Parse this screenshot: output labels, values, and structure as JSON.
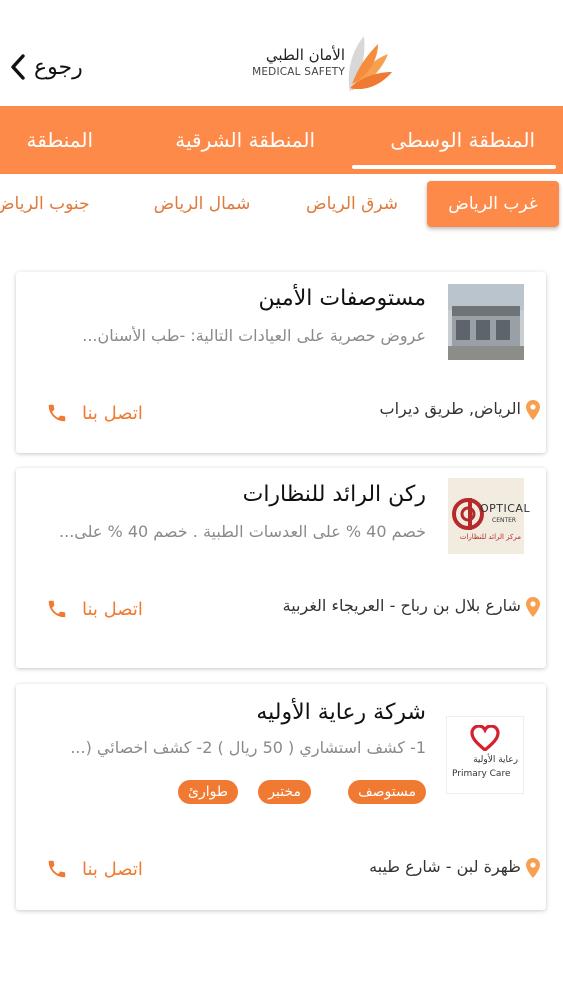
{
  "header": {
    "back_label": "رجوع",
    "logo_ar": "الأمان الطبي",
    "logo_en": "MEDICAL SAFETY"
  },
  "regions": [
    "المنطقة الوسطى",
    "المنطقة الشرقية",
    "المنطقة"
  ],
  "active_region": "المنطقة الوسطى",
  "subregions": [
    "غرب الرياض",
    "شرق الرياض",
    "شمال الرياض",
    "جنوب الرياض"
  ],
  "active_subregion": "غرب الرياض",
  "call_label": "اتصل بنا",
  "cards": [
    {
      "title": "مستوصفات الأمين",
      "desc": "عروض حصرية على العيادات التالية: -طب الأسنان...",
      "location": "الرياض, طريق ديراب"
    },
    {
      "title": "ركن الرائد للنظارات",
      "desc": "خصم 40 % على العدسات الطبية . خصم 40 % على...",
      "location": "شارع بلال بن رباح - العريجاء الغربية",
      "logo_text": "OPTICAL",
      "logo_sub": "CENTER",
      "logo_ar": "مركز الرائد للنظارات"
    },
    {
      "title": "شركة رعاية الأوليه",
      "desc": "1- كشف استشاري ( 50 ريال ) 2- كشف اخصائي (...",
      "location": "ظهرة لبن - شارع طيبه",
      "tags": [
        "مستوصف",
        "مختبر",
        "طوارئ"
      ],
      "logo_ar": "رعاية الأولية",
      "logo_en": "Primary Care"
    }
  ],
  "colors": {
    "accent": "#fe8a49",
    "accent_dark": "#f07a32"
  }
}
